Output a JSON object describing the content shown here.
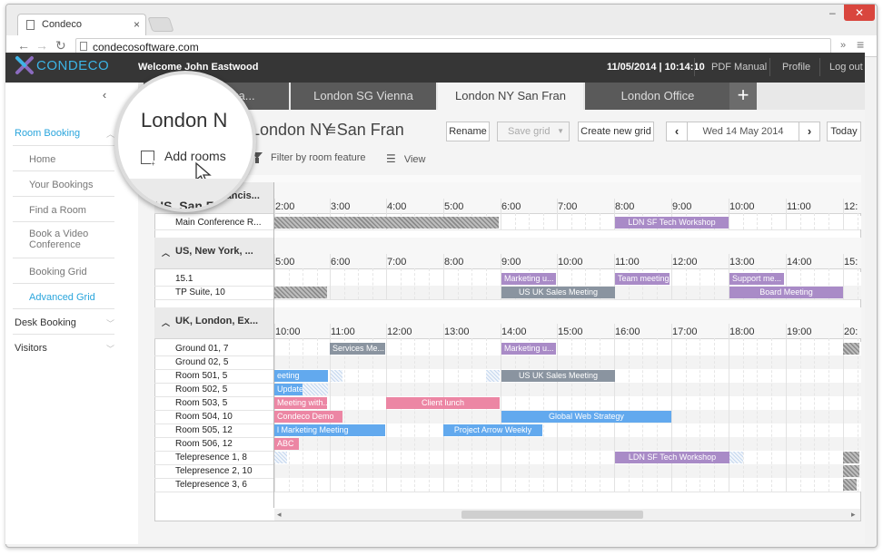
{
  "browser": {
    "tab_title": "Condeco",
    "url": "condecosoftware.com",
    "minimize": "–",
    "close": "✕"
  },
  "app": {
    "logo": "CONDECO",
    "welcome": "Welcome John Eastwood",
    "date": "11/05/2014",
    "time_sep": "|",
    "time": "10:14:10",
    "links": [
      "PDF Manual",
      "Profile",
      "Log out"
    ]
  },
  "sidebar": {
    "items": [
      {
        "label": "Room Booking",
        "style": "active-section"
      },
      {
        "label": "Home",
        "style": "sub"
      },
      {
        "label": "Your Bookings",
        "style": "sub"
      },
      {
        "label": "Find a Room",
        "style": "sub"
      },
      {
        "label": "Book a Video Conference",
        "style": "sub"
      },
      {
        "label": "Booking Grid",
        "style": "sub"
      },
      {
        "label": "Advanced Grid",
        "style": "sub-active"
      },
      {
        "label": "Desk Booking",
        "style": "section"
      },
      {
        "label": "Visitors",
        "style": "section"
      }
    ]
  },
  "grid_tabs": [
    "Paris - Singa...",
    "London SG Vienna",
    "London NY San Fran",
    "London Office"
  ],
  "grid_title": "London NY San Fran",
  "toolbar": {
    "rename": "Rename",
    "save_grid": "Save grid",
    "create_new_grid": "Create new grid",
    "date": "Wed 14 May 2014",
    "today": "Today",
    "add_rooms": "Add rooms",
    "filter": "Filter by room feature",
    "view": "View"
  },
  "sections": [
    {
      "title": "US, San Francis...",
      "times": [
        "2:00",
        "3:00",
        "4:00",
        "5:00",
        "6:00",
        "7:00",
        "8:00",
        "9:00",
        "10:00",
        "11:00",
        "12:"
      ],
      "rooms": [
        "Main Conference R..."
      ]
    },
    {
      "title": "US, New York, ...",
      "times": [
        "5:00",
        "6:00",
        "7:00",
        "8:00",
        "9:00",
        "10:00",
        "11:00",
        "12:00",
        "13:00",
        "14:00",
        "15:"
      ],
      "rooms": [
        "15.1",
        "TP Suite, 10"
      ]
    },
    {
      "title": "UK, London, Ex...",
      "times": [
        "10:00",
        "11:00",
        "12:00",
        "13:00",
        "14:00",
        "15:00",
        "16:00",
        "17:00",
        "18:00",
        "19:00",
        "20:"
      ],
      "rooms": [
        "Ground 01, 7",
        "Ground 02, 5",
        "Room 501, 5",
        "Room 502, 5",
        "Room 503, 5",
        "Room 504, 10",
        "Room 505, 12",
        "Room 506, 12",
        "Telepresence 1, 8",
        "Telepresence 2, 10",
        "Telepresence 3, 6"
      ]
    }
  ],
  "events": [
    {
      "label": "LDN SF Tech Workshop",
      "color": "purple",
      "row": 0
    },
    {
      "label": "Marketing u...",
      "color": "purple",
      "row": 1
    },
    {
      "label": "Team meeting",
      "color": "purple",
      "row": 1
    },
    {
      "label": "Support me...",
      "color": "purple",
      "row": 1
    },
    {
      "label": "US UK Sales Meeting",
      "color": "gray",
      "row": 2
    },
    {
      "label": "Board Meeting",
      "color": "purple",
      "row": 2
    },
    {
      "label": "Services Me...",
      "color": "gray",
      "row": 3
    },
    {
      "label": "Marketing u...",
      "color": "purple",
      "row": 3
    },
    {
      "label": "eeting",
      "color": "blue",
      "row": 5
    },
    {
      "label": "US UK Sales Meeting",
      "color": "gray",
      "row": 5
    },
    {
      "label": "Update",
      "color": "blue",
      "row": 6
    },
    {
      "label": "Meeting with...",
      "color": "pink",
      "row": 7
    },
    {
      "label": "Client lunch",
      "color": "pink",
      "row": 7
    },
    {
      "label": "Condeco Demo",
      "color": "pink",
      "row": 8
    },
    {
      "label": "Global Web Strategy",
      "color": "blue",
      "row": 8
    },
    {
      "label": "l Marketing Meeting",
      "color": "blue",
      "row": 9
    },
    {
      "label": "Project Arrow Weekly",
      "color": "blue",
      "row": 9
    },
    {
      "label": "ABC",
      "color": "pink",
      "row": 10
    },
    {
      "label": "LDN SF Tech Workshop",
      "color": "purple",
      "row": 11
    }
  ],
  "magnifier": {
    "title": "London N",
    "add_rooms": "Add rooms",
    "section": "US, San Fran"
  }
}
